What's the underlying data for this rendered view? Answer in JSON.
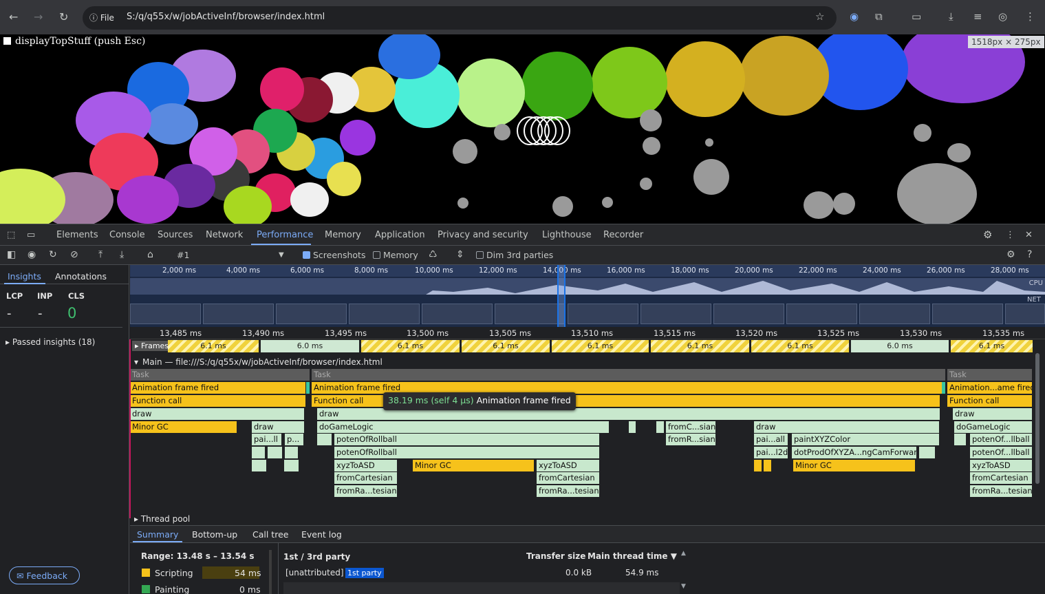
{
  "browser": {
    "url_chip": "File",
    "url": "S:/q/q55x/w/jobActiveInf/browser/index.html"
  },
  "page": {
    "debug_label": "displayTopStuff (push Esc)",
    "size_badge": "1518px × 275px"
  },
  "devtools": {
    "tabs": [
      "Elements",
      "Console",
      "Sources",
      "Network",
      "Performance",
      "Memory",
      "Application",
      "Privacy and security",
      "Lighthouse",
      "Recorder"
    ],
    "active_tab": "Performance",
    "toolbar": {
      "recording": "#1",
      "screenshots_label": "Screenshots",
      "screenshots_checked": true,
      "memory_label": "Memory",
      "memory_checked": false,
      "dim_label": "Dim 3rd parties",
      "dim_checked": false
    },
    "sidebar": {
      "tabs": [
        "Insights",
        "Annotations"
      ],
      "metrics": [
        {
          "name": "LCP",
          "value": "-"
        },
        {
          "name": "INP",
          "value": "-"
        },
        {
          "name": "CLS",
          "value": "0"
        }
      ],
      "passed": "Passed insights (18)",
      "feedback": "Feedback"
    },
    "overview_ticks": [
      "2,000 ms",
      "4,000 ms",
      "6,000 ms",
      "8,000 ms",
      "10,000 ms",
      "12,000 ms",
      "14,000 ms",
      "16,000 ms",
      "18,000 ms",
      "20,000 ms",
      "22,000 ms",
      "24,000 ms",
      "26,000 ms",
      "28,000 ms"
    ],
    "overview_labels": {
      "cpu": "CPU",
      "net": "NET"
    },
    "ruler_ticks": [
      "13,485 ms",
      "13,490 ms",
      "13,495 ms",
      "13,500 ms",
      "13,505 ms",
      "13,510 ms",
      "13,515 ms",
      "13,520 ms",
      "13,525 ms",
      "13,530 ms",
      "13,535 ms"
    ],
    "frames_label": "Frames",
    "frames": [
      "6.1 ms",
      "6.0 ms",
      "6.1 ms",
      "6.1 ms",
      "6.1 ms",
      "6.1 ms",
      "6.1 ms",
      "6.0 ms",
      "6.1 ms"
    ],
    "main_track": "Main — file:///S:/q/q55x/w/jobActiveInf/browser/index.html",
    "flame_labels": {
      "task": "Task",
      "anim": "Animation frame fired",
      "anim_short": "Animation...ame fired",
      "func": "Function call",
      "draw": "draw",
      "minor_gc": "Minor GC",
      "pai_ll": "pai...ll",
      "p_ell": "p...",
      "doGameLogic": "doGameLogic",
      "potenOfRollball": "potenOfRollball",
      "potenOf_llball": "potenOf...llball",
      "potenOf_llball2": "potenOf...llball",
      "xyzToASD": "xyzToASD",
      "fromCartesian": "fromCartesian",
      "fromRa_tesian": "fromRa...tesian",
      "fromC_sian": "fromC...sian",
      "fromR_sian": "fromR...sian",
      "pai_all": "pai...all",
      "paintXYZColor": "paintXYZColor",
      "pai_l2d": "pai...l2d",
      "dotProd": "dotProdOfXYZA...ngCamForward"
    },
    "tooltip": {
      "time": "38.19 ms (self 4 µs)",
      "label": "Animation frame fired"
    },
    "thread_pool": "Thread pool",
    "bottom_tabs": [
      "Summary",
      "Bottom-up",
      "Call tree",
      "Event log"
    ],
    "summary": {
      "range": "Range: 13.48 s – 13.54 s",
      "rows": [
        {
          "label": "Scripting",
          "value": "54 ms",
          "color": "#f6c21b"
        },
        {
          "label": "Painting",
          "value": "0 ms",
          "color": "#34a853"
        }
      ],
      "table_headers": {
        "party": "1st / 3rd party",
        "transfer": "Transfer size",
        "main": "Main thread time ▼"
      },
      "row": {
        "entity": "[unattributed]",
        "badge": "1st party",
        "transfer": "0.0 kB",
        "main": "54.9 ms"
      }
    }
  }
}
